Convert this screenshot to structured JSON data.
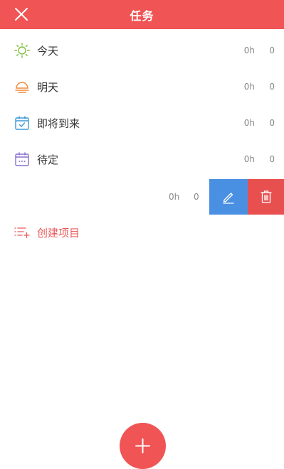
{
  "header": {
    "title": "任务"
  },
  "colors": {
    "accent": "#f05454",
    "edit": "#4a90e2",
    "delete": "#e85050"
  },
  "lists": [
    {
      "label": "今天",
      "hours": "0h",
      "count": "0",
      "icon": "sun-icon"
    },
    {
      "label": "明天",
      "hours": "0h",
      "count": "0",
      "icon": "sunrise-icon"
    },
    {
      "label": "即将到来",
      "hours": "0h",
      "count": "0",
      "icon": "calendar-check-icon"
    },
    {
      "label": "待定",
      "hours": "0h",
      "count": "0",
      "icon": "calendar-dots-icon"
    }
  ],
  "swiped_item": {
    "hours": "0h",
    "count": "0",
    "edit_icon": "pencil-icon",
    "delete_icon": "trash-icon"
  },
  "create_project": {
    "label": "创建项目",
    "icon": "list-add-icon"
  },
  "fab_icon": "plus-icon"
}
